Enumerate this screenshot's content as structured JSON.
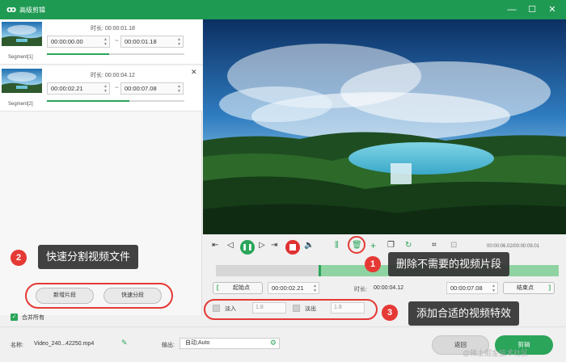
{
  "window": {
    "logo": "ꝏ",
    "title": "高级剪辑",
    "minimize": "—",
    "maximize": "☐",
    "close": "✕"
  },
  "segments": [
    {
      "label": "Segment[1]",
      "duration_label": "时长: 00:00:01.18",
      "start": "00:00:00.00",
      "end": "00:00:01.18",
      "progress": 0.45
    },
    {
      "label": "Segment[2]",
      "duration_label": "时长: 00:00:04.12",
      "start": "00:00:02.21",
      "end": "00:00:07.08",
      "progress": 0.6,
      "close": "✕"
    }
  ],
  "tilde": "~",
  "left_buttons": {
    "new_segment": "新增片段",
    "quick_split": "快速分段"
  },
  "merge_all": {
    "label": "合并所有",
    "checked": true,
    "checkmark": "✓"
  },
  "controls": {
    "time_readout": "00:00:06.02/00:00:09.01",
    "icons": {
      "mark_in": "⇤",
      "prev": "◁",
      "play": "❚❚",
      "next": "▷",
      "mark_out": "⇥",
      "volume": "🔈",
      "split": "⫼",
      "delete": "🗑",
      "add": "+",
      "copy": "❐",
      "reset": "↻",
      "crop": "⌗",
      "snap": "⊡"
    },
    "start_label": "起始点",
    "start_time": "00:00:02.21",
    "duration_label": "时长:",
    "duration_value": "00:00:04.12",
    "end_time": "00:00:07.08",
    "end_label": "结束点",
    "bracket_left": "[",
    "bracket_right": "]",
    "spin_up": "▲",
    "spin_down": "▼",
    "fade_in_label": "淡入",
    "fade_in_value": "1.8",
    "fade_out_label": "淡出",
    "fade_out_value": "1.8",
    "selection": [
      0.3,
      1.0
    ]
  },
  "bottom": {
    "name_label": "名称:",
    "name_value": "Video_240...42250.mp4",
    "edit_icon": "✎",
    "output_label": "输出:",
    "output_value": "自动;Auto",
    "gear_icon": "⚙",
    "back_button": "返回",
    "cut_button": "剪辑"
  },
  "annotations": [
    {
      "num": "1",
      "text": "删除不需要的视频片段"
    },
    {
      "num": "2",
      "text": "快速分割视频文件"
    },
    {
      "num": "3",
      "text": "添加合适的视频特效"
    }
  ],
  "watermark": "@稀土掘金技术社区",
  "colors": {
    "brand": "#1f9a53",
    "accent": "#2aa55a",
    "annotation": "#e53935"
  }
}
